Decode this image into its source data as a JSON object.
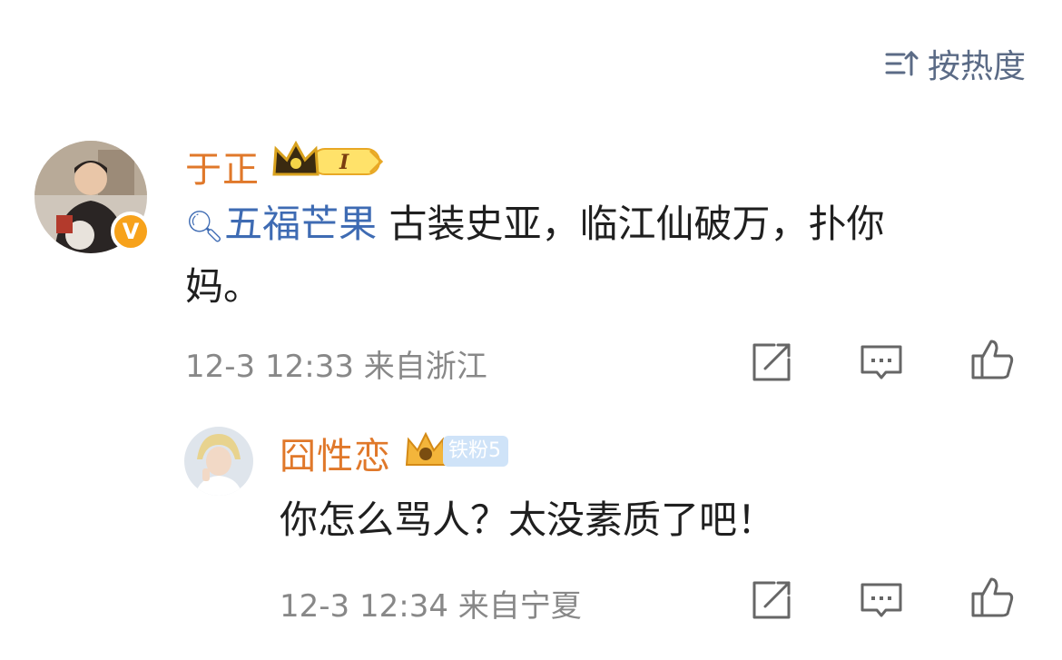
{
  "sort": {
    "label": "按热度",
    "icon": "sort-icon"
  },
  "comment": {
    "username": "于正",
    "badge_level": "I",
    "verified_mark": "V",
    "topic": "五福芒果",
    "text": "古装史亚，临江仙破万，扑你",
    "text_cont": "妈。",
    "timestamp": "12-3 12:33",
    "location": "来自浙江"
  },
  "reply": {
    "username": "囧性恋",
    "fan_badge": "铁粉5",
    "text": "你怎么骂人？太没素质了吧！",
    "timestamp": "12-3 12:34",
    "location": "来自宁夏"
  },
  "colors": {
    "username": "#e0782a",
    "link": "#3e6bb3",
    "meta": "#888888",
    "icon": "#5b6b86",
    "verified": "#f7a21b"
  }
}
